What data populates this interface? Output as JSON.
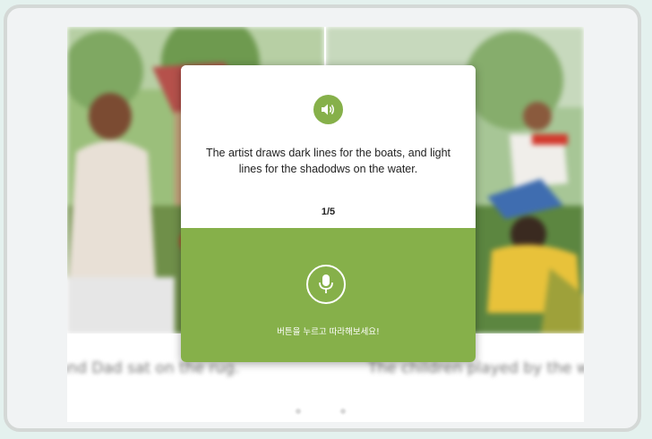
{
  "popup": {
    "sentence": "The artist draws dark lines for the boats, and light lines for the shadodws on the water.",
    "counter": "1/5",
    "mic_hint": "버튼을 누르고 따라해보세요!"
  },
  "background": {
    "left_caption": "and Dad sat on the rug.",
    "right_caption": "The children played by the water."
  },
  "colors": {
    "accent": "#86b04a",
    "page_bg": "#e4f1ee",
    "frame_border": "#d4d8d6"
  },
  "icons": {
    "speaker": "speaker-icon",
    "microphone": "microphone-icon"
  }
}
